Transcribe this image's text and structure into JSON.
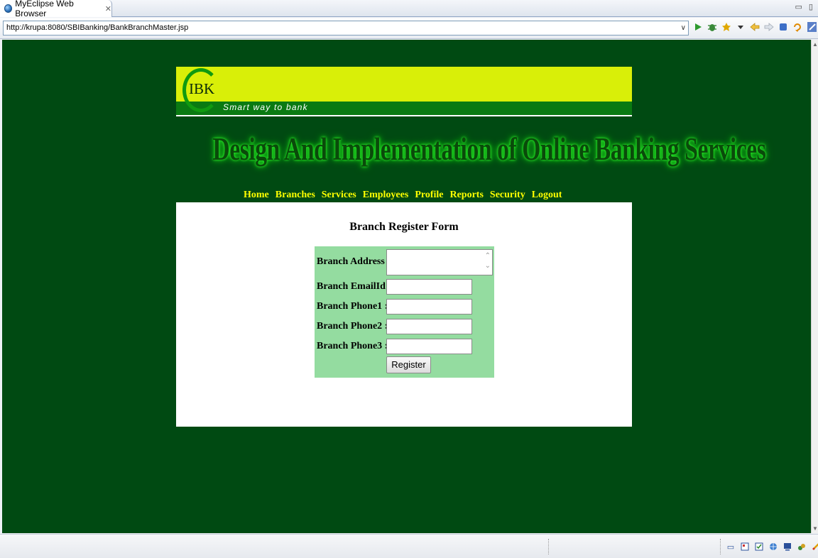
{
  "window": {
    "tab_title": "MyEclipse Web Browser",
    "tab_close": "✕",
    "controls": "▭ ▯"
  },
  "addressbar": {
    "url": "http://krupa:8080/SBIBanking/BankBranchMaster.jsp",
    "dropdown": "∨",
    "tools": [
      "run-icon",
      "debug-icon",
      "bookmark-icon",
      "menu-arrow-icon",
      "back-icon",
      "forward-icon",
      "stop-icon",
      "refresh-icon",
      "perspective-icon"
    ]
  },
  "banner": {
    "logo_text": "IBK",
    "tagline": "Smart way to bank"
  },
  "headline": "Design And Implementation of  Online Banking Services",
  "nav": [
    "Home",
    "Branches",
    "Services",
    "Employees",
    "Profile",
    "Reports",
    "Security",
    "Logout"
  ],
  "form": {
    "title": "Branch Register Form",
    "fields": [
      {
        "label": "Branch Address :",
        "value": ""
      },
      {
        "label": "Branch EmailId :",
        "value": ""
      },
      {
        "label": "Branch Phone1 :",
        "value": ""
      },
      {
        "label": "Branch Phone2 :",
        "value": ""
      },
      {
        "label": "Branch Phone3 :",
        "value": ""
      }
    ],
    "submit_label": "Register"
  },
  "colors": {
    "page_bg": "#004a12",
    "banner_bg": "#d9ef08",
    "nav_text": "#ffff00",
    "form_bg": "#94dca0"
  }
}
